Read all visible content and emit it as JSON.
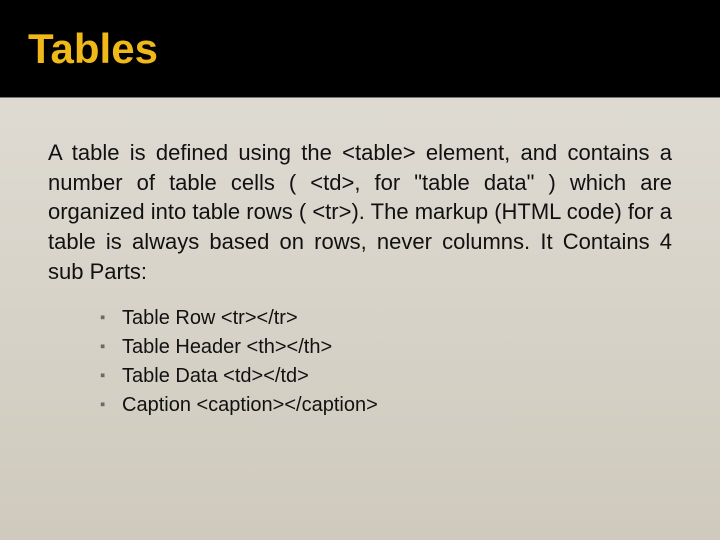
{
  "slide": {
    "title": "Tables",
    "paragraph": "A table is defined using the <table> element, and contains a number of table cells ( <td>, for \"table data\" ) which are organized into table rows ( <tr>). The markup (HTML code) for a table is always based on rows, never columns. It Contains 4 sub Parts:",
    "bullets": [
      "Table Row <tr></tr>",
      "Table Header <th></th>",
      "Table Data <td></td>",
      "Caption <caption></caption>"
    ]
  }
}
